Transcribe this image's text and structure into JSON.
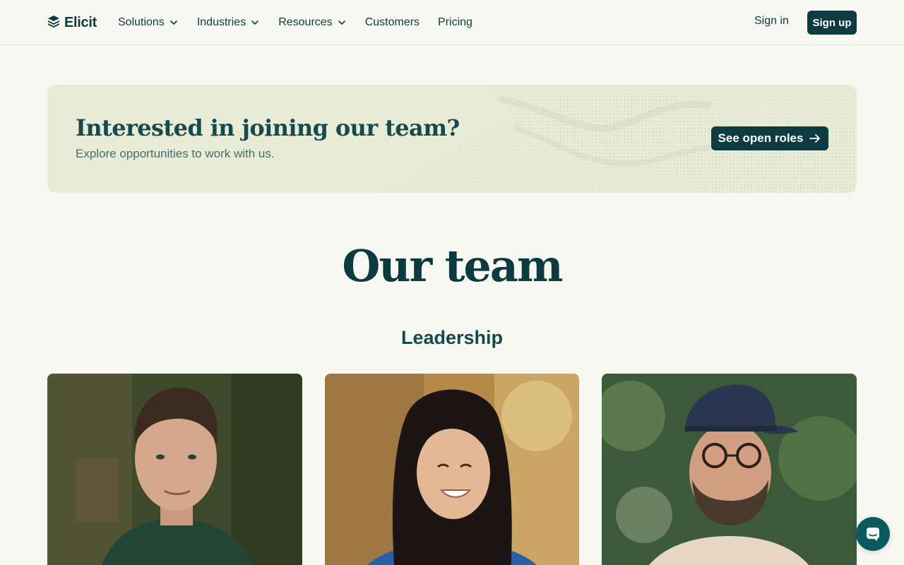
{
  "brand": {
    "name": "Elicit"
  },
  "nav": {
    "items": [
      {
        "label": "Solutions",
        "has_dropdown": true
      },
      {
        "label": "Industries",
        "has_dropdown": true
      },
      {
        "label": "Resources",
        "has_dropdown": true
      },
      {
        "label": "Customers",
        "has_dropdown": false
      },
      {
        "label": "Pricing",
        "has_dropdown": false
      }
    ],
    "sign_in": "Sign in",
    "sign_up": "Sign up"
  },
  "banner": {
    "title": "Interested in joining our team?",
    "subtitle": "Explore opportunities to work with us.",
    "button": "See open roles"
  },
  "team": {
    "title": "Our team",
    "section": "Leadership"
  },
  "colors": {
    "accent": "#0e3b41",
    "background": "#f8f8f2",
    "banner_bg": "#e8ebd6",
    "chat": "#0b5a60"
  },
  "icons": {
    "logo": "elicit-logo-icon",
    "dropdown": "chevron-down-icon",
    "arrow": "arrow-right-icon",
    "chat": "chat-icon"
  }
}
